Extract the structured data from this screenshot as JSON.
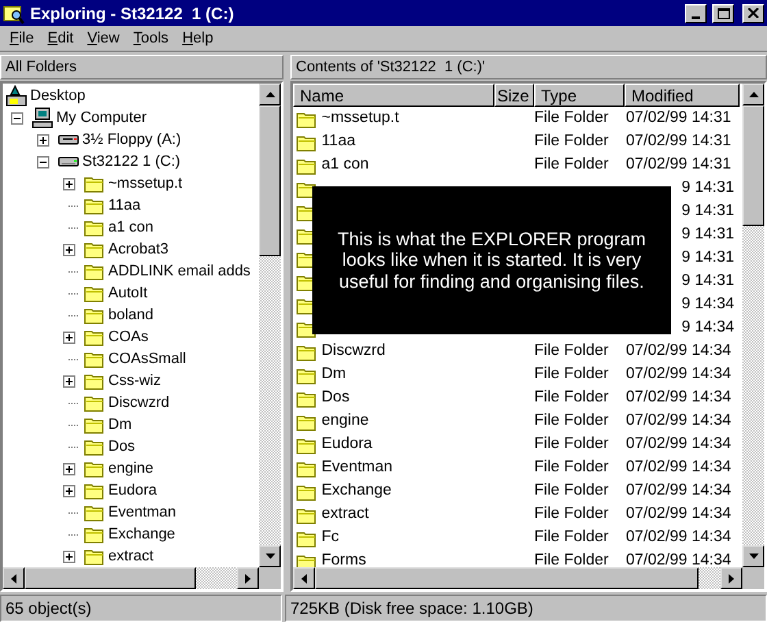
{
  "window": {
    "title": "Exploring - St32122  1 (C:)"
  },
  "menu": [
    "File",
    "Edit",
    "View",
    "Tools",
    "Help"
  ],
  "left_header": "All Folders",
  "right_header": "Contents of 'St32122  1 (C:)'",
  "tree": [
    {
      "label": "Desktop",
      "kind": "desktop",
      "children": [
        {
          "label": "My Computer",
          "kind": "computer",
          "expandable": true,
          "expanded": true,
          "children": [
            {
              "label": "3½ Floppy (A:)",
              "kind": "floppy",
              "expandable": true,
              "expanded": false
            },
            {
              "label": "St32122  1 (C:)",
              "kind": "drive",
              "expandable": true,
              "expanded": true,
              "children": [
                {
                  "label": "~mssetup.t",
                  "kind": "folder",
                  "expandable": true,
                  "expanded": false
                },
                {
                  "label": "11aa",
                  "kind": "folder",
                  "expandable": false
                },
                {
                  "label": "a1 con",
                  "kind": "folder",
                  "expandable": false
                },
                {
                  "label": "Acrobat3",
                  "kind": "folder",
                  "expandable": true,
                  "expanded": false
                },
                {
                  "label": "ADDLINK email adds",
                  "kind": "folder",
                  "expandable": false
                },
                {
                  "label": "AutoIt",
                  "kind": "folder",
                  "expandable": false
                },
                {
                  "label": "boland",
                  "kind": "folder",
                  "expandable": false
                },
                {
                  "label": "COAs",
                  "kind": "folder",
                  "expandable": true,
                  "expanded": false
                },
                {
                  "label": "COAsSmall",
                  "kind": "folder",
                  "expandable": false
                },
                {
                  "label": "Css-wiz",
                  "kind": "folder",
                  "expandable": true,
                  "expanded": false
                },
                {
                  "label": "Discwzrd",
                  "kind": "folder",
                  "expandable": false
                },
                {
                  "label": "Dm",
                  "kind": "folder",
                  "expandable": false
                },
                {
                  "label": "Dos",
                  "kind": "folder",
                  "expandable": false
                },
                {
                  "label": "engine",
                  "kind": "folder",
                  "expandable": true,
                  "expanded": false
                },
                {
                  "label": "Eudora",
                  "kind": "folder",
                  "expandable": true,
                  "expanded": false
                },
                {
                  "label": "Eventman",
                  "kind": "folder",
                  "expandable": false
                },
                {
                  "label": "Exchange",
                  "kind": "folder",
                  "expandable": false
                },
                {
                  "label": "extract",
                  "kind": "folder",
                  "expandable": true,
                  "expanded": false
                }
              ]
            }
          ]
        }
      ]
    }
  ],
  "columns": [
    "Name",
    "Size",
    "Type",
    "Modified"
  ],
  "rows": [
    {
      "name": "~mssetup.t",
      "type": "File Folder",
      "modified": "07/02/99 14:31"
    },
    {
      "name": "11aa",
      "type": "File Folder",
      "modified": "07/02/99 14:31"
    },
    {
      "name": "a1 con",
      "type": "File Folder",
      "modified": "07/02/99 14:31"
    },
    {
      "modified": "9 14:31"
    },
    {
      "modified": "9 14:31"
    },
    {
      "modified": "9 14:31"
    },
    {
      "modified": "9 14:31"
    },
    {
      "modified": "9 14:31"
    },
    {
      "modified": "9 14:34"
    },
    {
      "modified": "9 14:34"
    },
    {
      "name": "Discwzrd",
      "type": "File Folder",
      "modified": "07/02/99 14:34"
    },
    {
      "name": "Dm",
      "type": "File Folder",
      "modified": "07/02/99 14:34"
    },
    {
      "name": "Dos",
      "type": "File Folder",
      "modified": "07/02/99 14:34"
    },
    {
      "name": "engine",
      "type": "File Folder",
      "modified": "07/02/99 14:34"
    },
    {
      "name": "Eudora",
      "type": "File Folder",
      "modified": "07/02/99 14:34"
    },
    {
      "name": "Eventman",
      "type": "File Folder",
      "modified": "07/02/99 14:34"
    },
    {
      "name": "Exchange",
      "type": "File Folder",
      "modified": "07/02/99 14:34"
    },
    {
      "name": "extract",
      "type": "File Folder",
      "modified": "07/02/99 14:34"
    },
    {
      "name": "Fc",
      "type": "File Folder",
      "modified": "07/02/99 14:34"
    },
    {
      "name": "Forms",
      "type": "File Folder",
      "modified": "07/02/99 14:34"
    }
  ],
  "callout": "This is what the EXPLORER program looks like when it is started. It is very useful for finding and organising  files.",
  "status_bar": [
    "65 object(s)",
    "725KB (Disk free space: 1.10GB)"
  ]
}
